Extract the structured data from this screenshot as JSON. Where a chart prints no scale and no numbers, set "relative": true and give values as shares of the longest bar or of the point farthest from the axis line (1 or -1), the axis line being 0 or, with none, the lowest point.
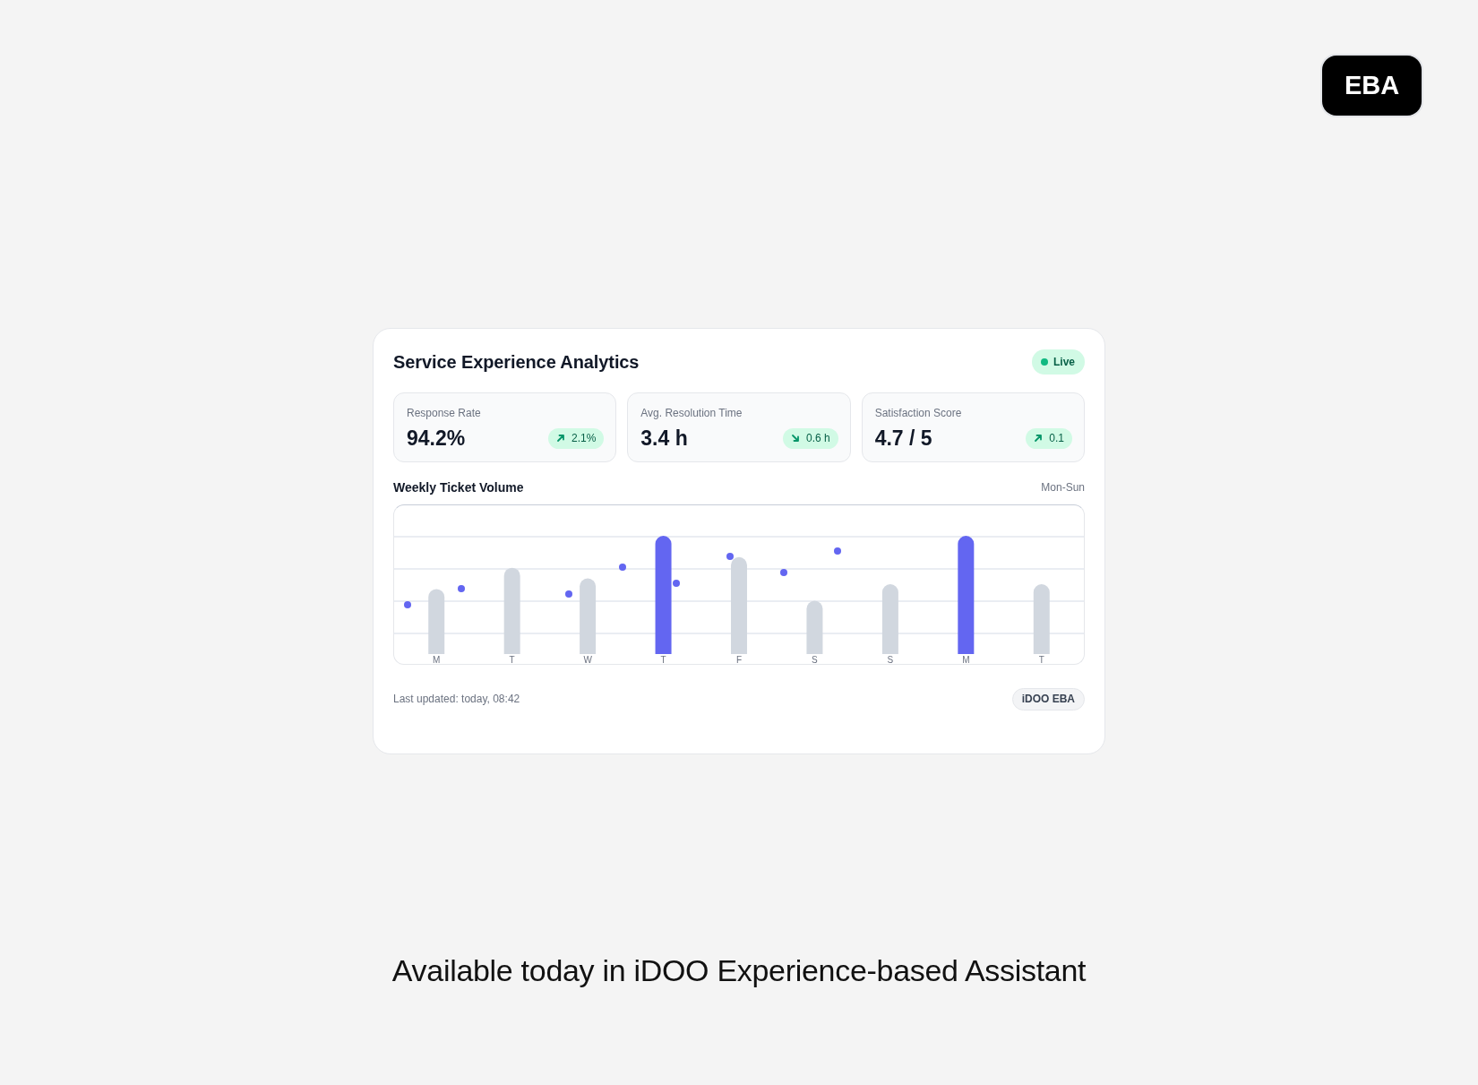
{
  "logo": {
    "text": "EBA"
  },
  "card": {
    "title": "Service Experience Analytics",
    "status": {
      "label": "Live"
    },
    "metrics": [
      {
        "label": "Response Rate",
        "value": "94.2%",
        "delta": "2.1%",
        "kind": "up"
      },
      {
        "label": "Avg. Resolution Time",
        "value": "3.4 h",
        "delta": "0.6 h",
        "kind": "down"
      },
      {
        "label": "Satisfaction Score",
        "value": "4.7 / 5",
        "delta": "0.1",
        "kind": "up"
      }
    ],
    "chart": {
      "title": "Weekly Ticket Volume",
      "range": "Mon-Sun",
      "chart_data": {
        "type": "bar",
        "relative": true,
        "categories": [
          "M",
          "T",
          "W",
          "T",
          "F",
          "S",
          "S",
          "M",
          "T"
        ],
        "values": [
          0.55,
          0.73,
          0.64,
          1,
          0.82,
          0.45,
          0.59,
          1,
          0.59
        ]
      }
    },
    "footer": {
      "updated": "Last updated: today, 08:42",
      "tag": "iDOO EBA"
    }
  },
  "tagline": "Available today in iDOO Experience-based Assistant"
}
